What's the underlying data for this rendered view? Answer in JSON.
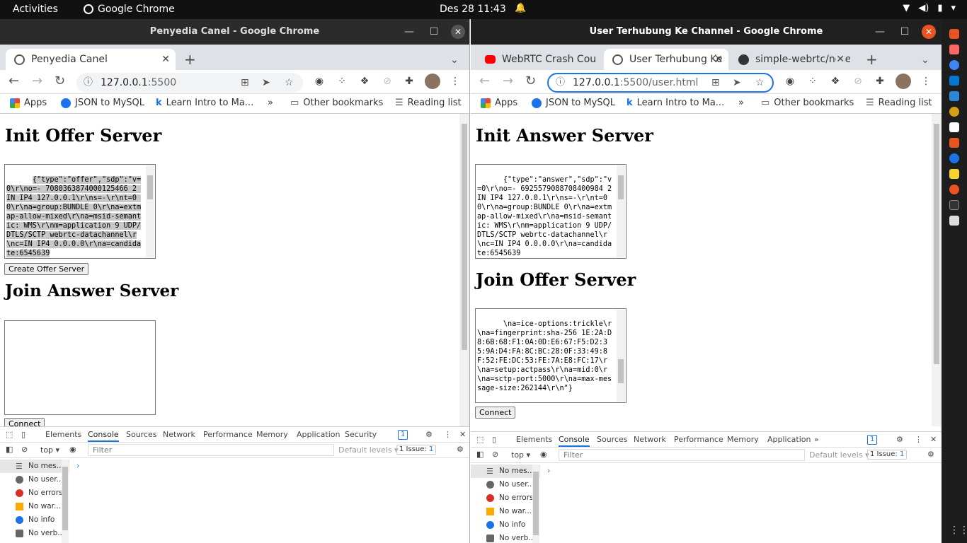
{
  "topbar": {
    "activities": "Activities",
    "app_name": "Google Chrome",
    "datetime": "Des 28  11:43"
  },
  "left_window": {
    "title": "Penyedia Canel - Google Chrome",
    "tabs": [
      {
        "label": "Penyedia Canel"
      }
    ],
    "url": "127.0.0.1",
    "url_port": ":5500",
    "bookmarks": [
      "Apps",
      "JSON to MySQL",
      "Learn Intro to Ma...",
      "»",
      "Other bookmarks",
      "Reading list"
    ],
    "page": {
      "heading1": "Init Offer Server",
      "offer_text": "{\"type\":\"offer\",\"sdp\":\"v=0\\r\\no=- 7080363874000125466 2 IN IP4 127.0.0.1\\r\\ns=-\\r\\nt=0 0\\r\\na=group:BUNDLE 0\\r\\na=extmap-allow-mixed\\r\\na=msid-semantic: WMS\\r\\nm=application 9 UDP/DTLS/SCTP webrtc-datachannel\\r\\nc=IN IP4 0.0.0.0\\r\\na=candidate:6545639",
      "create_offer_label": "Create Offer Server",
      "heading2": "Join Answer Server",
      "connect_label": "Connect"
    },
    "devtools": {
      "tabs": [
        "Elements",
        "Console",
        "Sources",
        "Network",
        "Performance",
        "Memory",
        "Application",
        "Security"
      ],
      "badge": "1",
      "context": "top ▾",
      "filter_placeholder": "Filter",
      "levels": "Default levels ▾",
      "issues": "1 Issue:",
      "issues_count": "1",
      "sidebar": [
        "No mes...",
        "No user...",
        "No errors",
        "No war...",
        "No info",
        "No verb..."
      ]
    }
  },
  "right_window": {
    "title": "User Terhubung Ke Channel - Google Chrome",
    "tabs": [
      {
        "label": "WebRTC Crash Cou"
      },
      {
        "label": "User Terhubung Ke"
      },
      {
        "label": "simple-webrtc/note"
      }
    ],
    "url": "127.0.0.1",
    "url_rest": ":5500/user.html",
    "bookmarks": [
      "Apps",
      "JSON to MySQL",
      "Learn Intro to Ma...",
      "»",
      "Other bookmarks",
      "Reading list"
    ],
    "page": {
      "heading1": "Init Answer Server",
      "answer_text": "{\"type\":\"answer\",\"sdp\":\"v=0\\r\\no=- 6925579088708400984 2 IN IP4 127.0.0.1\\r\\ns=-\\r\\nt=0 0\\r\\na=group:BUNDLE 0\\r\\na=extmap-allow-mixed\\r\\na=msid-semantic: WMS\\r\\nm=application 9 UDP/DTLS/SCTP webrtc-datachannel\\r\\nc=IN IP4 0.0.0.0\\r\\na=candidate:6545639",
      "heading2": "Join Offer Server",
      "join_text": "\\na=ice-options:trickle\\r\\na=fingerprint:sha-256 1E:2A:D8:6B:68:F1:0A:0D:E6:67:F5:D2:35:9A:D4:FA:8C:BC:28:0F:33:49:8F:52:FE:DC:53:FE:7A:E8:FC:17\\r\\na=setup:actpass\\r\\na=mid:0\\r\\na=sctp-port:5000\\r\\na=max-message-size:262144\\r\\n\"}",
      "connect_label": "Connect"
    },
    "devtools": {
      "tabs": [
        "Elements",
        "Console",
        "Sources",
        "Network",
        "Performance",
        "Memory",
        "Application",
        "»"
      ],
      "badge": "1",
      "context": "top ▾",
      "filter_placeholder": "Filter",
      "levels": "Default levels ▾",
      "issues": "1 Issue:",
      "issues_count": "1",
      "sidebar": [
        "No mes...",
        "No user...",
        "No errors",
        "No war...",
        "No info",
        "No verb..."
      ]
    }
  }
}
